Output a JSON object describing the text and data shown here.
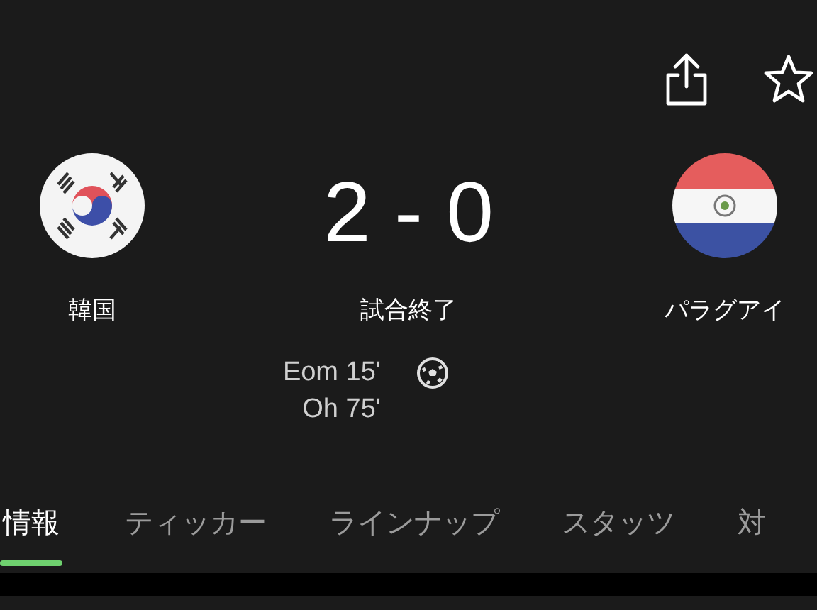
{
  "home": {
    "name": "韓国"
  },
  "away": {
    "name": "パラグアイ"
  },
  "score": "2 - 0",
  "status": "試合終了",
  "goals": [
    {
      "text": "Eom 15'"
    },
    {
      "text": "Oh 75'"
    }
  ],
  "tabs": [
    {
      "label": "情報",
      "selected": true
    },
    {
      "label": "ティッカー",
      "selected": false
    },
    {
      "label": "ラインナップ",
      "selected": false
    },
    {
      "label": "スタッツ",
      "selected": false
    },
    {
      "label": "対",
      "selected": false
    }
  ]
}
